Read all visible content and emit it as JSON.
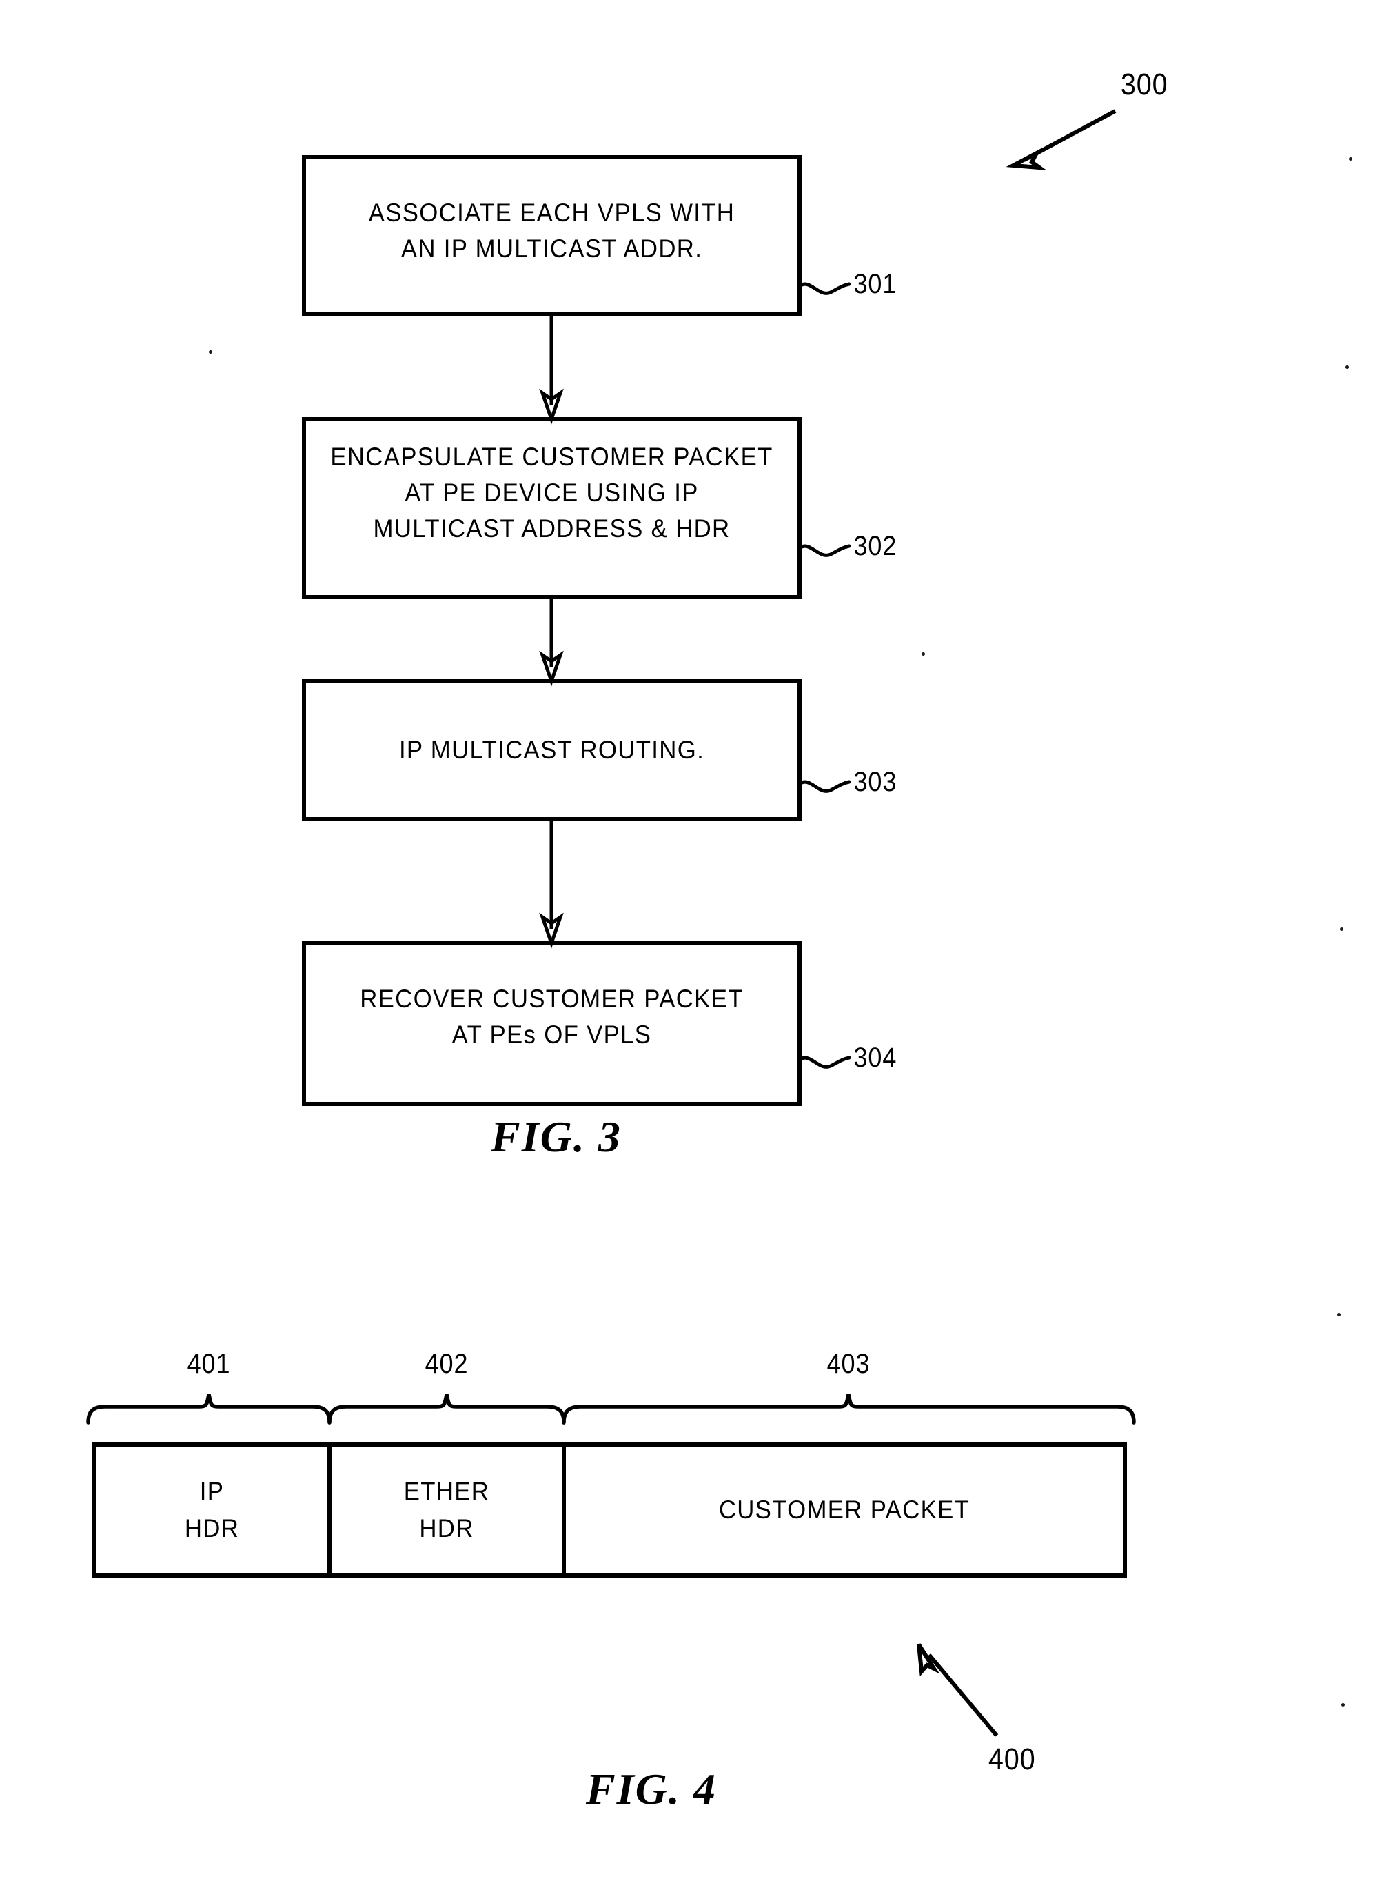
{
  "document": {
    "type": "patent-drawing-sheet",
    "figures": [
      "FIG. 3",
      "FIG. 4"
    ]
  },
  "fig3": {
    "caption": "FIG. 3",
    "diagram_ref": "300",
    "steps": [
      {
        "ref": "301",
        "text": "ASSOCIATE EACH VPLS WITH\nAN IP MULTICAST ADDR."
      },
      {
        "ref": "302",
        "text": "ENCAPSULATE CUSTOMER PACKET\nAT PE DEVICE USING IP\nMULTICAST ADDRESS & HDR"
      },
      {
        "ref": "303",
        "text": "IP MULTICAST ROUTING."
      },
      {
        "ref": "304",
        "text": "RECOVER CUSTOMER PACKET\nAT PEs OF VPLS"
      }
    ]
  },
  "fig4": {
    "caption": "FIG. 4",
    "diagram_ref": "400",
    "fields": [
      {
        "ref": "401",
        "text": "IP\nHDR"
      },
      {
        "ref": "402",
        "text": "ETHER\nHDR"
      },
      {
        "ref": "403",
        "text": "CUSTOMER PACKET"
      }
    ]
  },
  "colors": {
    "ink": "#000000",
    "paper": "#ffffff"
  }
}
